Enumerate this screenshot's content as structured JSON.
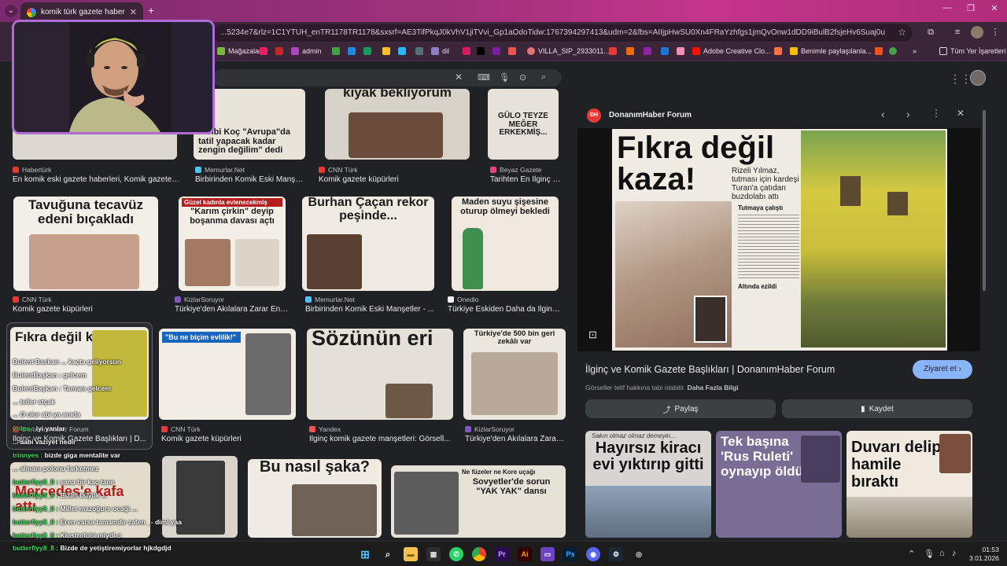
{
  "browser": {
    "tab_title": "komik türk gazete haberi - Goo",
    "new_tab": "+",
    "url": "...5234e7&rlz=1C1YTUH_enTR1178TR1178&sxsrf=AE3TifPkqJ0kVhV1jiTVvi_Gp1aOdoTidw:1767394297413&udm=2&fbs=AIIjpHwSU0Xn4FRaYzhfgs1jmQvOnw1dDD9iBulB2fsjeHv6Suaj0uWGr65idqq_D8h15TYd...",
    "bookmarks": {
      "magazalar": "Mağazalar",
      "admin": "admin",
      "dil": "dil",
      "villa": "VILLA_SIP_2933011...",
      "adobe": "Adobe Creative Clo...",
      "shared": "Benimle paylaşılanla...",
      "all": "Tüm Yer İşaretleri"
    },
    "accent_color": "#a0327c"
  },
  "results": [
    {
      "source": "Habertürk",
      "caption": "En komik eski gazete haberleri, Komik gazete h...",
      "headline": ""
    },
    {
      "source": "Memurlar.Net",
      "caption": "Birbirinden Komik Eski Manşet...",
      "headline": "Venbi Koç \"Avrupa\"da tatil yapacak kadar zengin değilim\" dedi"
    },
    {
      "source": "CNN Türk",
      "caption": "Komik gazete küpürleri",
      "headline": "kıyak bekliyorum"
    },
    {
      "source": "Beyaz Gazete",
      "caption": "Tarihten En İlginç E...",
      "headline": "GÜLO TEYZE MEĞER ERKEKMİŞ..."
    },
    {
      "source": "CNN Türk",
      "caption": "Komik gazete küpürleri",
      "headline": "Tavuğuna tecavüz edeni bıçakladı"
    },
    {
      "source": "KizlarSoruyor",
      "caption": "Türkiye'den Akılalara Zarar En K...",
      "headline": "\"Karım çirkin\" deyip boşanma davası açtı",
      "kicker": "Güzel kadınla evlenecekmiş"
    },
    {
      "source": "Memurlar.Net",
      "caption": "Birbirinden Komik Eski Manşetler - ...",
      "headline": "Burhan Çaçan rekor peşinde..."
    },
    {
      "source": "Onedio",
      "caption": "Türkiye Eskiden Daha da İlginç ...",
      "headline": "Maden suyu şişesine oturup ölmeyi bekledi"
    },
    {
      "source": "DonanımHaber Forum",
      "caption": "İlginç ve Komik Gazete Başlıkları | D...",
      "headline": "Fıkra değil kaza!"
    },
    {
      "source": "CNN Türk",
      "caption": "Komik gazete küpürleri",
      "headline": "\"Bu ne biçim evlilik!\""
    },
    {
      "source": "Yandex",
      "caption": "İlginç komik gazete manşetleri: Görsell...",
      "headline": "Sözünün eri"
    },
    {
      "source": "KizlarSoruyor",
      "caption": "Türkiye'den Akılalara Zarar ...",
      "headline": "Türkiye'de 500 bin geri zekâlı var"
    },
    {
      "source": "",
      "caption": "",
      "headline": "Mercedes'e kafa attı"
    },
    {
      "source": "",
      "caption": "",
      "headline": ""
    },
    {
      "source": "",
      "caption": "",
      "headline": "Bu nasıl şaka?"
    },
    {
      "source": "",
      "caption": "",
      "headline": "Sovyetler'de sorun \"YAK YAK\" dansı",
      "kicker": "Ne füzeler ne Kore uçağı"
    }
  ],
  "panel": {
    "source": "DonanımHaber Forum",
    "logo": "DH",
    "hero_headline": "Fıkra değil kaza!",
    "hero_sub": "Rizeli Yılmaz, tutması için kardeşi Turan'a çatıdan buzdolabı attı",
    "hero_section1": "Tutmaya çalıştı",
    "hero_section2": "Altında ezildi",
    "title": "İlginç ve Komik Gazete Başlıkları | DonanımHaber Forum",
    "visit_label": "Ziyaret et",
    "note": "Görseller telif hakkına tabi olabilir.",
    "note_link": "Daha Fazla Bilgi",
    "share_label": "Paylaş",
    "save_label": "Kaydet",
    "related": [
      {
        "headline": "Hayırsız kiracı evi yıktırıp gitti",
        "kicker": "Sakın olmaz olmaz demeyin..."
      },
      {
        "headline": "Tek başına 'Rus Ruleti' oynayıp öldü",
        "kicker": ""
      },
      {
        "headline": "Duvarı delip hamile bıraktı",
        "kicker": ""
      }
    ]
  },
  "chat": [
    {
      "user": "",
      "msg": "Bulent Baskan ... kaçta geliyorsun"
    },
    {
      "user": "",
      "msg": "BulentBaşkan : gelcem"
    },
    {
      "user": "",
      "msg": "BulentBaşkan : Tamam gelcem"
    },
    {
      "user": "",
      "msg": "... teller stçak"
    },
    {
      "user": "",
      "msg": "... O olur abi ya arada"
    },
    {
      "user": "vrilex :",
      "msg": "iyi yanlar"
    },
    {
      "user": "",
      "msg": "... aabi vaziyet nedir"
    },
    {
      "user": "trinnyes :",
      "msg": "bizde giga mentalite var"
    },
    {
      "user": "",
      "msg": "... almanı polonu farketmez"
    },
    {
      "user": "butterflyy8_8 :",
      "msg": "sana bir kaç tane"
    },
    {
      "user": "butterflyy8_8 :",
      "msg": "Bizim büyük ..."
    },
    {
      "user": "butterflyy8_8 :",
      "msg": "Millet mazoğurs ocağı ..."
    },
    {
      "user": "butterflyy8_8 :",
      "msg": "Eren varsa tamamdır zaten _- dimi yaa"
    },
    {
      "user": "butterflyy8_8 :",
      "msg": "Klostrofobi miydi o"
    },
    {
      "user": "butterflyy8_8 :",
      "msg": "Bizde de yetiştiremiyorlar hjkdgdjd"
    }
  ],
  "taskbar": {
    "time": "01:53",
    "date": "3.01.2026"
  }
}
